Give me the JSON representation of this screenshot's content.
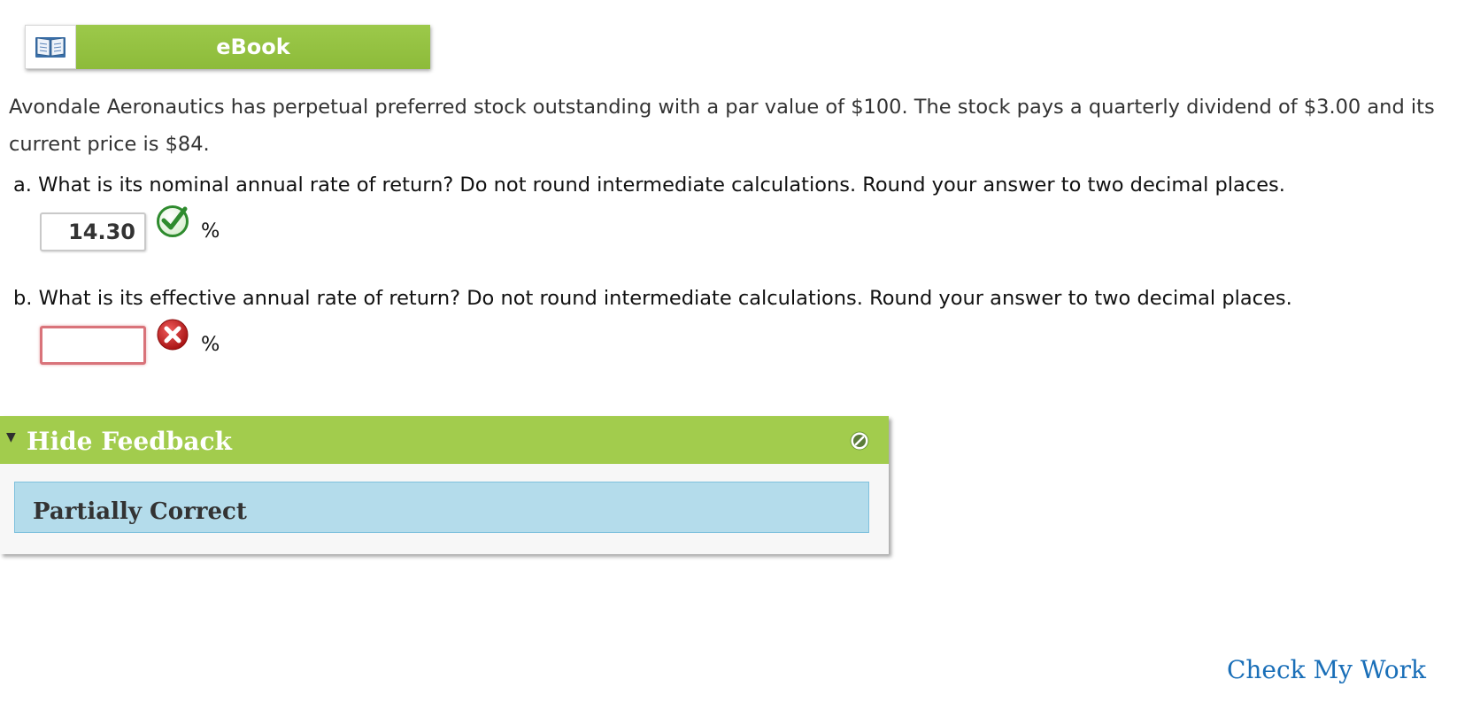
{
  "ebook": {
    "label": "eBook",
    "icon": "open-book-icon"
  },
  "problem": {
    "text": "Avondale Aeronautics has perpetual preferred stock outstanding with a par value of $100. The stock pays a quarterly dividend of $3.00 and its current price is $84."
  },
  "questions": [
    {
      "prompt": "a. What is its nominal annual rate of return? Do not round intermediate calculations. Round your answer to two decimal places.",
      "answer": "14.30",
      "unit": "%",
      "status": "correct",
      "status_icon": "green-checkmark-icon"
    },
    {
      "prompt": "b. What is its effective annual rate of return? Do not round intermediate calculations. Round your answer to two decimal places.",
      "answer": "",
      "unit": "%",
      "status": "incorrect",
      "status_icon": "red-x-icon"
    }
  ],
  "feedback": {
    "toggle_label": "Hide Feedback",
    "status": "Partially Correct"
  },
  "actions": {
    "check_my_work": "Check My Work"
  },
  "colors": {
    "accent_green": "#a2cc4d",
    "feedback_blue": "#b4dceb",
    "link_blue": "#1a6fb8",
    "error_red": "#d9737a"
  }
}
